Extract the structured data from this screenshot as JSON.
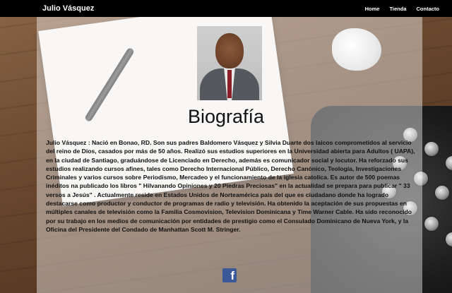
{
  "navbar": {
    "brand": "Julio Vásquez",
    "links": [
      "Home",
      "Tienda",
      "Contacto"
    ]
  },
  "main": {
    "title": "Biografía",
    "bio": "Julio Vásquez : Nació en Bonao, RD. Son sus padres Baldomero Vásquez y Silvia Duarte dos laicos comprometidos al servicio del reino de Dios, casados por más de 50 años. Realizó sus estudios superiores en la Universidad abierta para Adultos ( UAPA), en la ciudad de Santiago, graduándose de Licenciado en Derecho, además es comunicador social y locutor. Ha reforzado sus estudios realizando cursos afines, tales como Derecho Internacional Público, Derecho Canónico, Teología, Investigaciones Criminales y varios cursos sobre Periodismo, Mercadeo y el funcionamiento de la iglesia catolica. Es autor de 500 poemas inéditos na publicado los libros \" Hilvanando Opiniones y 20 Piedras Preciosas\" en la actualidad se prepara para publicar \" 33 versos a Jesús\" . Actualmente reside en Estados Unidos de Norteamérica país del que es ciudadano donde ha logrado destacarse como productor y conductor de programas de radio y televisión. Ha obtenido la aceptación de sus propuestas en múltiples canales de televisión como la Familia Cosmovision, Television Dominicana y Time Warner Cable. Ha sido reconocido por su trabajo en los medios de comunicación por entidades de prestigio como el Consulado Dominicano de Nueva York, y la Oficina del Presidente del Condado de Manhattan Scott M. Stringer."
  },
  "footer": {
    "facebook_icon": "facebook-icon",
    "facebook_glyph": "f"
  },
  "colors": {
    "navbar": "#000000",
    "facebook": "#3b5998"
  }
}
